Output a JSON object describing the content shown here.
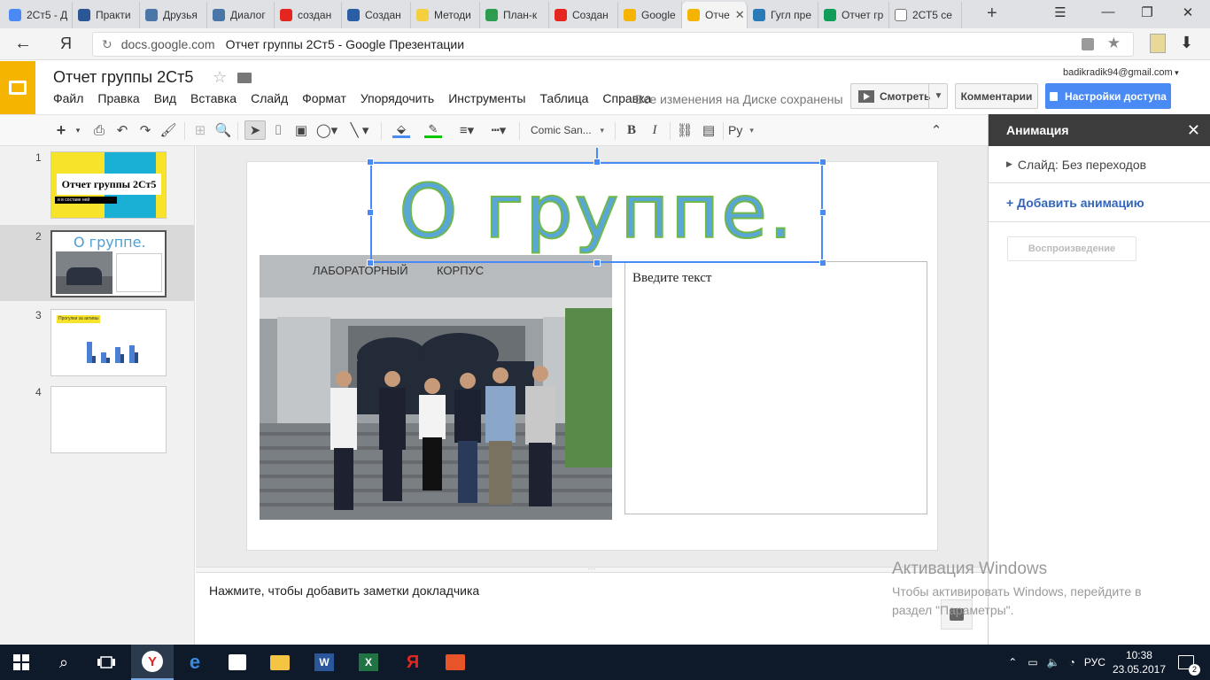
{
  "browser": {
    "tabs": [
      {
        "label": "2Ст5 - Д",
        "icon_color": "#4a8af4",
        "icon": "b"
      },
      {
        "label": "Практи",
        "icon_color": "#2b5797",
        "icon": "S"
      },
      {
        "label": "Друзья",
        "icon_color": "#4a76a8",
        "icon": "vk"
      },
      {
        "label": "Диалог",
        "icon_color": "#4a76a8",
        "icon": "chat"
      },
      {
        "label": "создан",
        "icon_color": "#e52620",
        "icon": "Я"
      },
      {
        "label": "Создан",
        "icon_color": "#2a5fa8",
        "icon": "book"
      },
      {
        "label": "Методи",
        "icon_color": "#f4d03f",
        "icon": "pin"
      },
      {
        "label": "План-к",
        "icon_color": "#2e9c4f",
        "icon": "check"
      },
      {
        "label": "Создан",
        "icon_color": "#e52620",
        "icon": "Я"
      },
      {
        "label": "Google",
        "icon_color": "#f4b400",
        "icon": "slides"
      },
      {
        "label": "Отче",
        "icon_color": "#f4b400",
        "icon": "slides",
        "active": true
      },
      {
        "label": "Гугл пре",
        "icon_color": "#2a7ab8",
        "icon": "play"
      },
      {
        "label": "Отчет гр",
        "icon_color": "#0f9d58",
        "icon": "sheets"
      },
      {
        "label": "2СТ5 се",
        "icon_color": "#ffffff",
        "icon": "doc"
      }
    ],
    "close_glyph": "✕",
    "new_tab_glyph": "+",
    "address": {
      "domain": "docs.google.com",
      "page_title": "Отчет группы 2Ст5 - Google Презентации"
    },
    "yandex_logo": "Я"
  },
  "docs": {
    "title": "Отчет группы 2Ст5",
    "menu": [
      "Файл",
      "Правка",
      "Вид",
      "Вставка",
      "Слайд",
      "Формат",
      "Упорядочить",
      "Инструменты",
      "Таблица",
      "Справка"
    ],
    "save_status": "Все изменения на Диске сохранены",
    "user_email": "badikradik94@gmail.com",
    "present_label": "Смотреть",
    "comments_label": "Комментарии",
    "share_label": "Настройки доступа",
    "accent_color": "#4a8af4"
  },
  "toolbar": {
    "font": "Comic San...",
    "lang": "Ру",
    "fill_color": "#4a8af4",
    "border_color": "#00c800"
  },
  "filmstrip": {
    "slides": [
      {
        "number": "1",
        "title": "Отчет группы 2Ст5",
        "subtitle": "и в составе ней"
      },
      {
        "number": "2",
        "title": "О группе."
      },
      {
        "number": "3",
        "title": "Прогулки за активы"
      },
      {
        "number": "4",
        "title": ""
      }
    ]
  },
  "slide": {
    "title": "О группе.",
    "text_placeholder": "Введите текст",
    "photo_sign_1": "ЛАБОРАТОРНЫЙ",
    "photo_sign_2": "КОРПУС"
  },
  "notes": {
    "placeholder": "Нажмите, чтобы добавить заметки докладчика"
  },
  "animation_panel": {
    "title": "Анимация",
    "transition": "Слайд: Без переходов",
    "add_animation": "+ Добавить анимацию",
    "play": "Воспроизведение"
  },
  "activation": {
    "title": "Активация Windows",
    "body": "Чтобы активировать Windows, перейдите в раздел \"Параметры\"."
  },
  "taskbar": {
    "lang": "РУС",
    "time": "10:38",
    "date": "23.05.2017",
    "notifications": "2"
  }
}
